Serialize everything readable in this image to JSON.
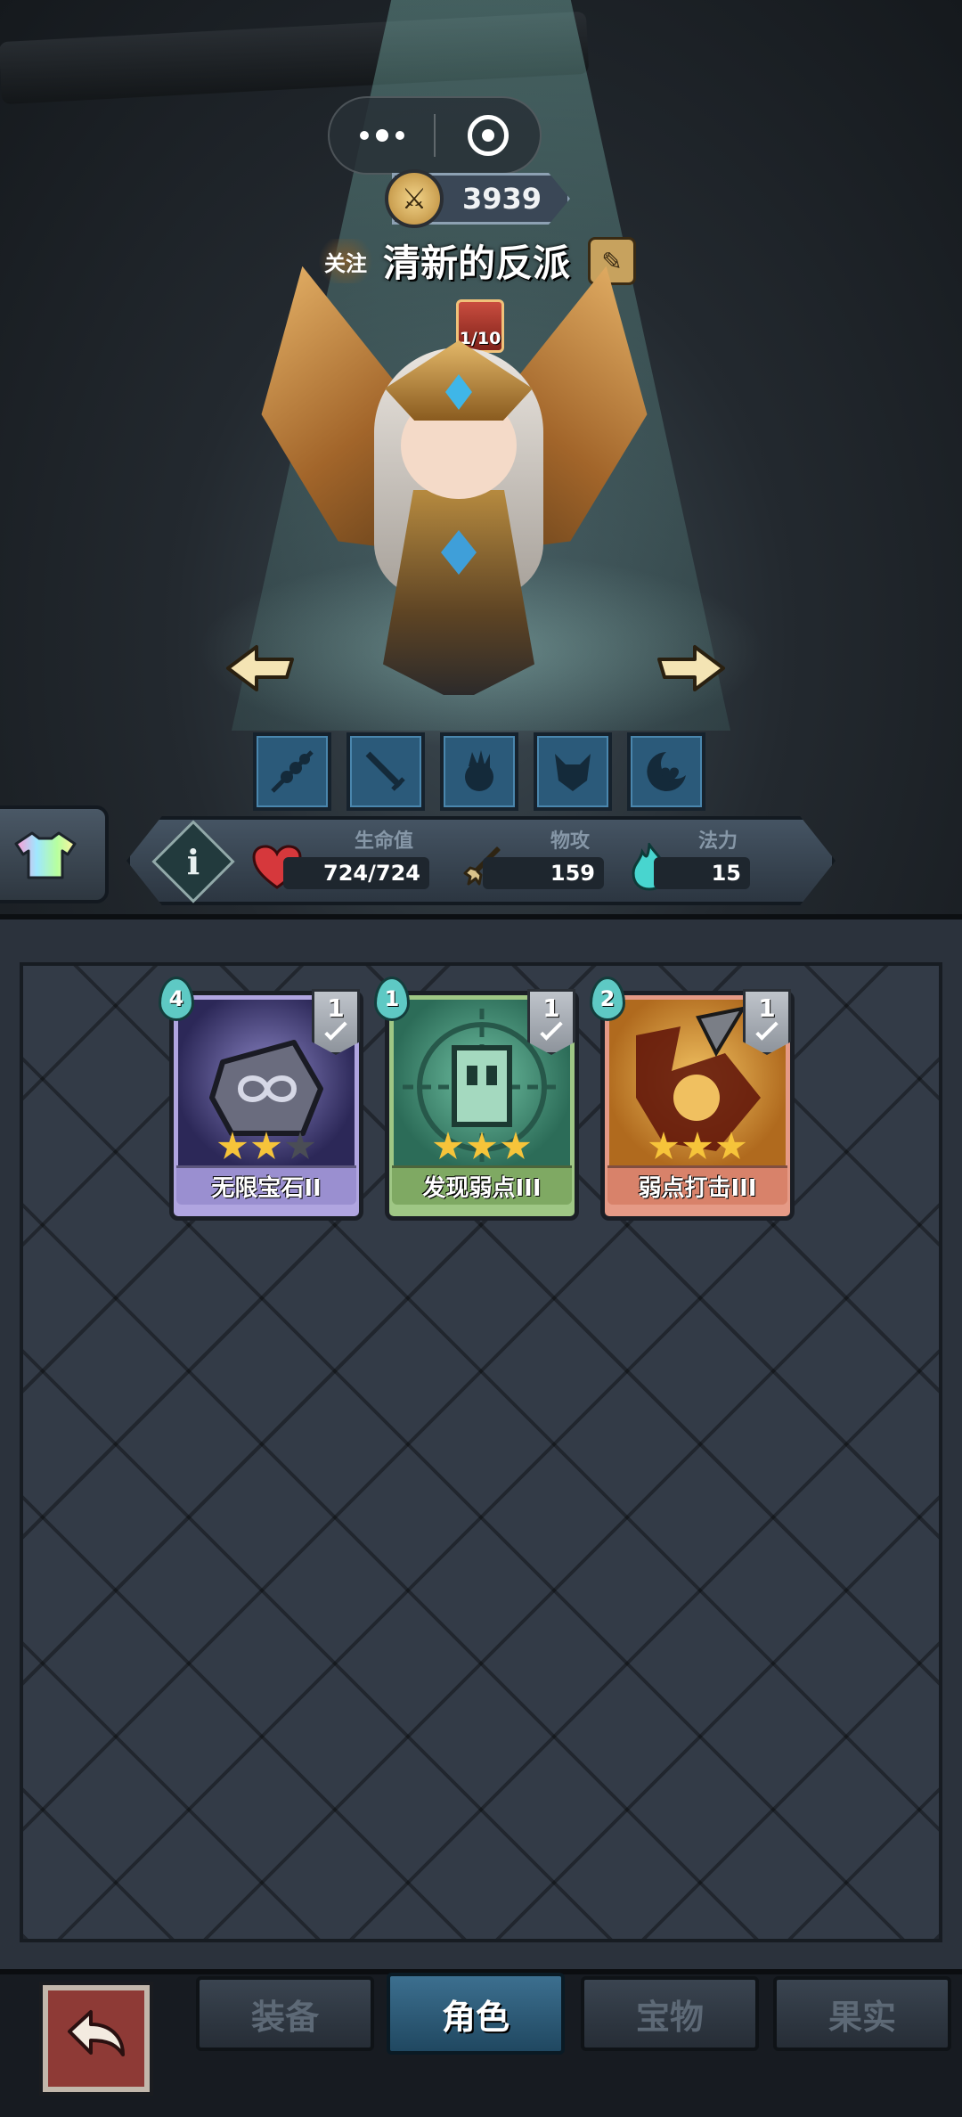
{
  "hero": {
    "power": "3939",
    "follow_label": "关注",
    "name": "清新的反派",
    "level_badge": "1/10"
  },
  "skills": [
    "skewer-skill-icon",
    "sword-skill-icon",
    "spirit-skill-icon",
    "demon-skill-icon",
    "moon-heart-skill-icon"
  ],
  "stats": {
    "hp_label": "生命值",
    "hp_value": "724/724",
    "attack_label": "物攻",
    "attack_value": "159",
    "mana_label": "法力",
    "mana_value": "15"
  },
  "cards": [
    {
      "name": "无限宝石II",
      "cost": "4",
      "count": "1",
      "stars_filled": 2,
      "stars_total": 3,
      "color": "#9a8fd0"
    },
    {
      "name": "发现弱点III",
      "cost": "1",
      "count": "1",
      "stars_filled": 3,
      "stars_total": 3,
      "color": "#7fa963"
    },
    {
      "name": "弱点打击III",
      "cost": "2",
      "count": "1",
      "stars_filled": 3,
      "stars_total": 3,
      "color": "#d8826a"
    }
  ],
  "tabs": [
    {
      "label": "装备",
      "active": false
    },
    {
      "label": "角色",
      "active": true
    },
    {
      "label": "宝物",
      "active": false
    },
    {
      "label": "果实",
      "active": false
    }
  ],
  "colors": {
    "accent_teal": "#5ec9c4",
    "active_tab": "#3c6f8f",
    "star_gold": "#f6c43a"
  }
}
